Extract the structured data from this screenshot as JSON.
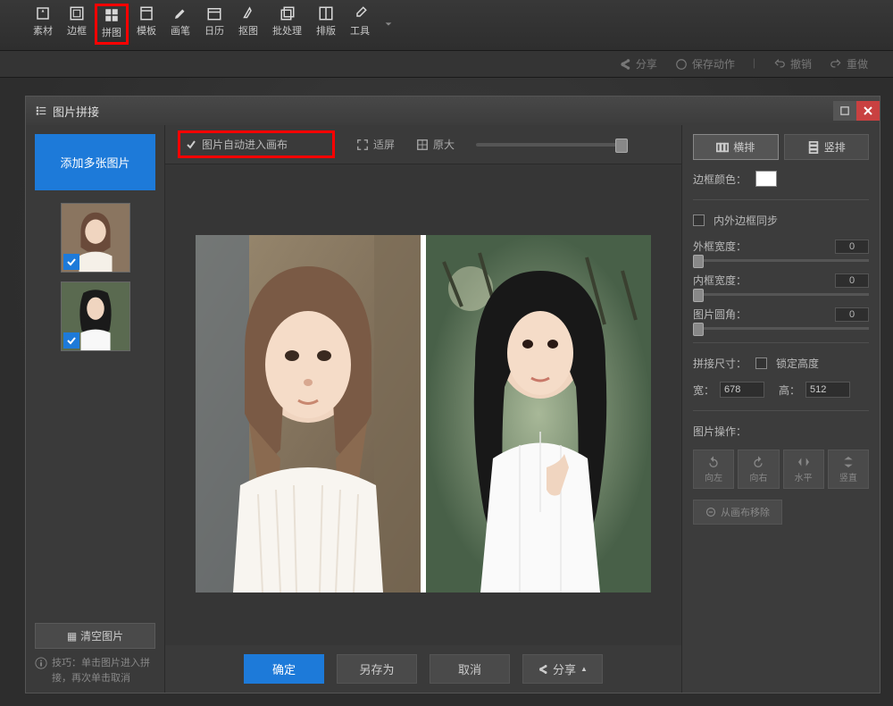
{
  "topTools": [
    "素材",
    "边框",
    "拼图",
    "模板",
    "画笔",
    "日历",
    "抠图",
    "批处理",
    "排版",
    "工具"
  ],
  "subbar": {
    "share": "分享",
    "save_action": "保存动作",
    "undo": "撤销",
    "redo": "重做"
  },
  "dialog": {
    "title": "图片拼接",
    "add_images": "添加多张图片",
    "clear": "清空图片",
    "tip": "技巧：单击图片进入拼接，再次单击取消",
    "auto_enter": "图片自动进入画布",
    "fit": "适屏",
    "original": "原大",
    "ok": "确定",
    "save_as": "另存为",
    "cancel": "取消",
    "share_btn": "分享"
  },
  "right": {
    "horizontal": "横排",
    "vertical": "竖排",
    "border_color": "边框颜色：",
    "sync_border": "内外边框同步",
    "outer_width": "外框宽度：",
    "inner_width": "内框宽度：",
    "corner": "图片圆角：",
    "outer_val": "0",
    "inner_val": "0",
    "corner_val": "0",
    "splice_size": "拼接尺寸：",
    "lock_height": "锁定高度",
    "width_label": "宽：",
    "height_label": "高：",
    "width_val": "678",
    "height_val": "512",
    "image_ops": "图片操作：",
    "rotate_left": "向左",
    "rotate_right": "向右",
    "flip_h": "水平",
    "flip_v": "竖直",
    "remove_canvas": "从画布移除"
  }
}
